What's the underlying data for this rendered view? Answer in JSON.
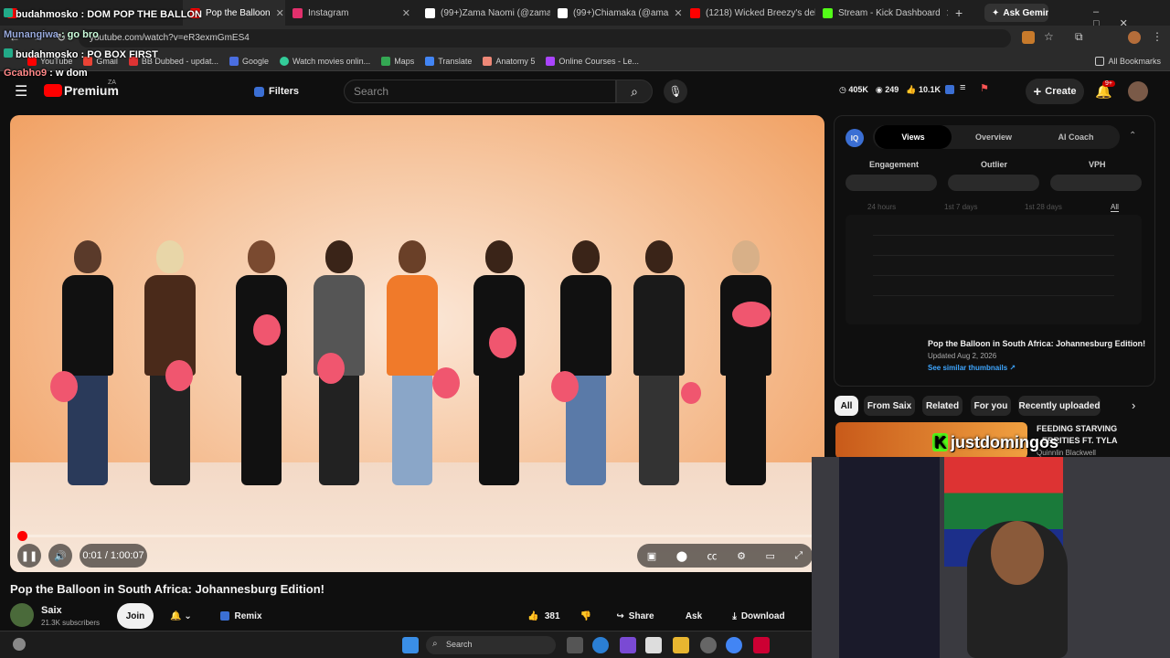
{
  "browser": {
    "tabs": [
      {
        "label": "budahmosko : DOM POP THE BALLON",
        "color": "#ff0000"
      },
      {
        "label": "Pop the Balloon",
        "color": "#ff0000"
      },
      {
        "label": "Instagram",
        "color": "#e1306c"
      },
      {
        "label": "(99+)Zama Naomi (@zama",
        "color": "#ffffff"
      },
      {
        "label": "(99+)Chiamaka (@ama",
        "color": "#ffffff"
      },
      {
        "label": "(1218) Wicked Breezy's del",
        "color": "#ff0000"
      },
      {
        "label": "Stream - Kick Dashboard",
        "color": "#53fc18"
      }
    ],
    "new_tab": "+",
    "ask_gemini": "Ask Gemini",
    "url": "youtube.com/watch?v=eR3exmGmES4",
    "bookmarks": [
      "YouTube",
      "Gmail",
      "BB Dubbed - updat...",
      "Google",
      "Watch movies onlin...",
      "Maps",
      "Translate",
      "Anatomy 5",
      "Online Courses - Le..."
    ],
    "all_bookmarks": "All Bookmarks"
  },
  "youtube": {
    "brand": "Premium",
    "region": "ZA",
    "filters": "Filters",
    "search_placeholder": "Search",
    "stats": {
      "subs": "405K",
      "views": "249",
      "likes": "10.1K"
    },
    "create": "Create",
    "notifications": "9+"
  },
  "player": {
    "time": "0:01 / 1:00:07",
    "progress": 0.0003
  },
  "video": {
    "title": "Pop the Balloon in South Africa: Johannesburg Edition!",
    "channel": "Saix",
    "subscribers": "21.3K subscribers",
    "join": "Join",
    "remix": "Remix",
    "likes": "381",
    "share": "Share",
    "ask": "Ask",
    "download": "Download"
  },
  "iq_panel": {
    "tabs": [
      "Views",
      "Overview",
      "AI Coach"
    ],
    "metrics": [
      "Engagement",
      "Outlier",
      "VPH"
    ],
    "ranges": [
      "24 hours",
      "1st 7 days",
      "1st 28 days",
      "All"
    ],
    "video_title": "Pop the Balloon in South Africa: Johannesburg Edition!",
    "updated": "Updated Aug 2, 2026",
    "similar": "See similar thumbnails ↗"
  },
  "chips": [
    "All",
    "From Saix",
    "Related",
    "For you",
    "Recently uploaded"
  ],
  "recommended": {
    "title_line1": "FEEDING STARVING",
    "title_line2": "EBRITIES FT. TYLA",
    "channel": "Quinnlin Blackwell"
  },
  "stream_overlay": {
    "chat": [
      {
        "user": "budahmosko",
        "msg": "DOM POP THE BALLON"
      },
      {
        "user": "Munangiwa",
        "msg": "go bro"
      },
      {
        "user": "budahmosko",
        "msg": "PO BOX FIRST"
      },
      {
        "user": "Gcabho9",
        "msg": "w dom"
      }
    ],
    "username": "justdomingos"
  },
  "taskbar": {
    "search": "Search"
  }
}
